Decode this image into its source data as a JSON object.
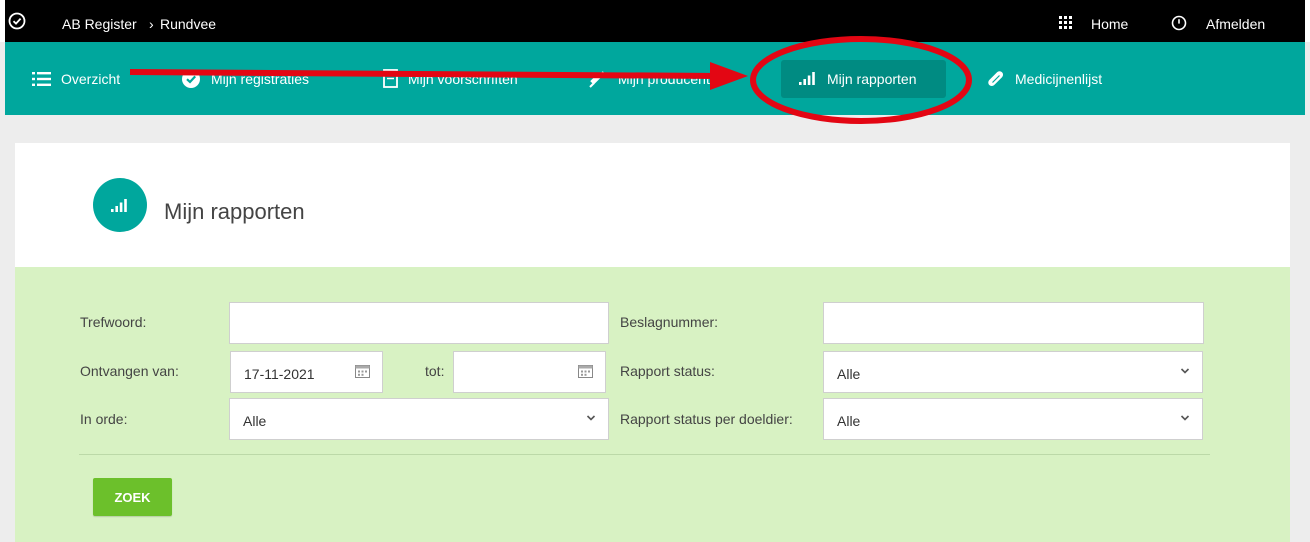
{
  "topbar": {
    "breadcrumb_root": "AB Register",
    "breadcrumb_separator": "›",
    "breadcrumb_current": "Rundvee",
    "home_label": "Home",
    "logout_label": "Afmelden"
  },
  "nav": {
    "items": [
      {
        "label": "Overzicht",
        "icon": "list-icon"
      },
      {
        "label": "Mijn registraties",
        "icon": "check-circle-icon"
      },
      {
        "label": "Mijn voorschriften",
        "icon": "document-icon"
      },
      {
        "label": "Mijn producenten",
        "icon": "syringe-icon"
      },
      {
        "label": "Mijn rapporten",
        "icon": "bar-signal-icon",
        "active": true
      },
      {
        "label": "Medicijnenlijst",
        "icon": "pill-icon"
      }
    ]
  },
  "page": {
    "title": "Mijn rapporten"
  },
  "form": {
    "trefwoord_label": "Trefwoord:",
    "trefwoord_value": "",
    "beslagnummer_label": "Beslagnummer:",
    "beslagnummer_value": "",
    "ontvangen_van_label": "Ontvangen van:",
    "ontvangen_van_value": "17-11-2021",
    "tot_label": "tot:",
    "tot_value": "",
    "rapport_status_label": "Rapport status:",
    "rapport_status_value": "Alle",
    "in_orde_label": "In orde:",
    "in_orde_value": "Alle",
    "rapport_status_doeldier_label": "Rapport status per doeldier:",
    "rapport_status_doeldier_value": "Alle",
    "search_button": "ZOEK"
  },
  "colors": {
    "nav_bg": "#00a79d",
    "nav_active_bg": "#008b82",
    "form_bg": "#d8f2c3",
    "button_bg": "#6cc02b",
    "annotation": "#e30613"
  }
}
